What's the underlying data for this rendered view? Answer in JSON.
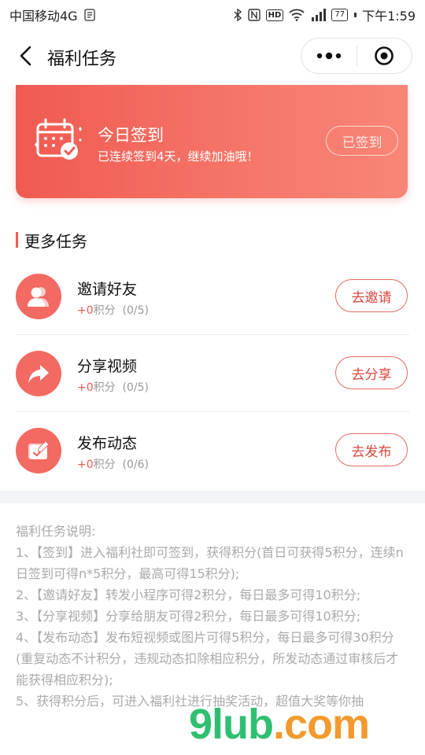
{
  "status_bar": {
    "carrier": "中国移动4G",
    "time": "下午1:59",
    "battery": "77",
    "icons": [
      "sim-icon",
      "bluetooth-icon",
      "nfc-icon",
      "hd-icon",
      "wifi-icon",
      "signal-icon",
      "battery-icon"
    ]
  },
  "nav": {
    "title": "福利任务"
  },
  "checkin": {
    "title": "今日签到",
    "subtitle": "已连续签到4天，继续加油哦！",
    "button": "已签到"
  },
  "section": {
    "title": "更多任务"
  },
  "tasks": [
    {
      "name": "邀请好友",
      "points": "+0",
      "points_unit": "积分",
      "progress": "(0/5)",
      "button": "去邀请",
      "icon": "invite-friends-icon"
    },
    {
      "name": "分享视频",
      "points": "+0",
      "points_unit": "积分",
      "progress": "(0/5)",
      "button": "去分享",
      "icon": "share-icon"
    },
    {
      "name": "发布动态",
      "points": "+0",
      "points_unit": "积分",
      "progress": "(0/6)",
      "button": "去发布",
      "icon": "post-icon"
    }
  ],
  "description": {
    "title": "福利任务说明:",
    "items": [
      "1、【签到】进入福利社即可签到，获得积分(首日可获得5积分，连续n日签到可得n*5积分，最高可得15积分);",
      "2、【邀请好友】转发小程序可得2积分，每日最多可得10积分;",
      "3、【分享视频】分享给朋友可得2积分，每日最多可得10积分;",
      "4、【发布动态】发布短视频或图片可得5积分，每日最多可得30积分(重复动态不计积分，违规动态扣除相应积分，所发动态通过审核后才能获得相应积分);",
      "5、获得积分后，可进入福利社进行抽奖活动，超值大奖等你抽"
    ]
  },
  "watermark": {
    "part1": "9lub",
    "part2": ".com"
  },
  "colors": {
    "accent": "#f05a52",
    "button_text": "#d9473e"
  }
}
